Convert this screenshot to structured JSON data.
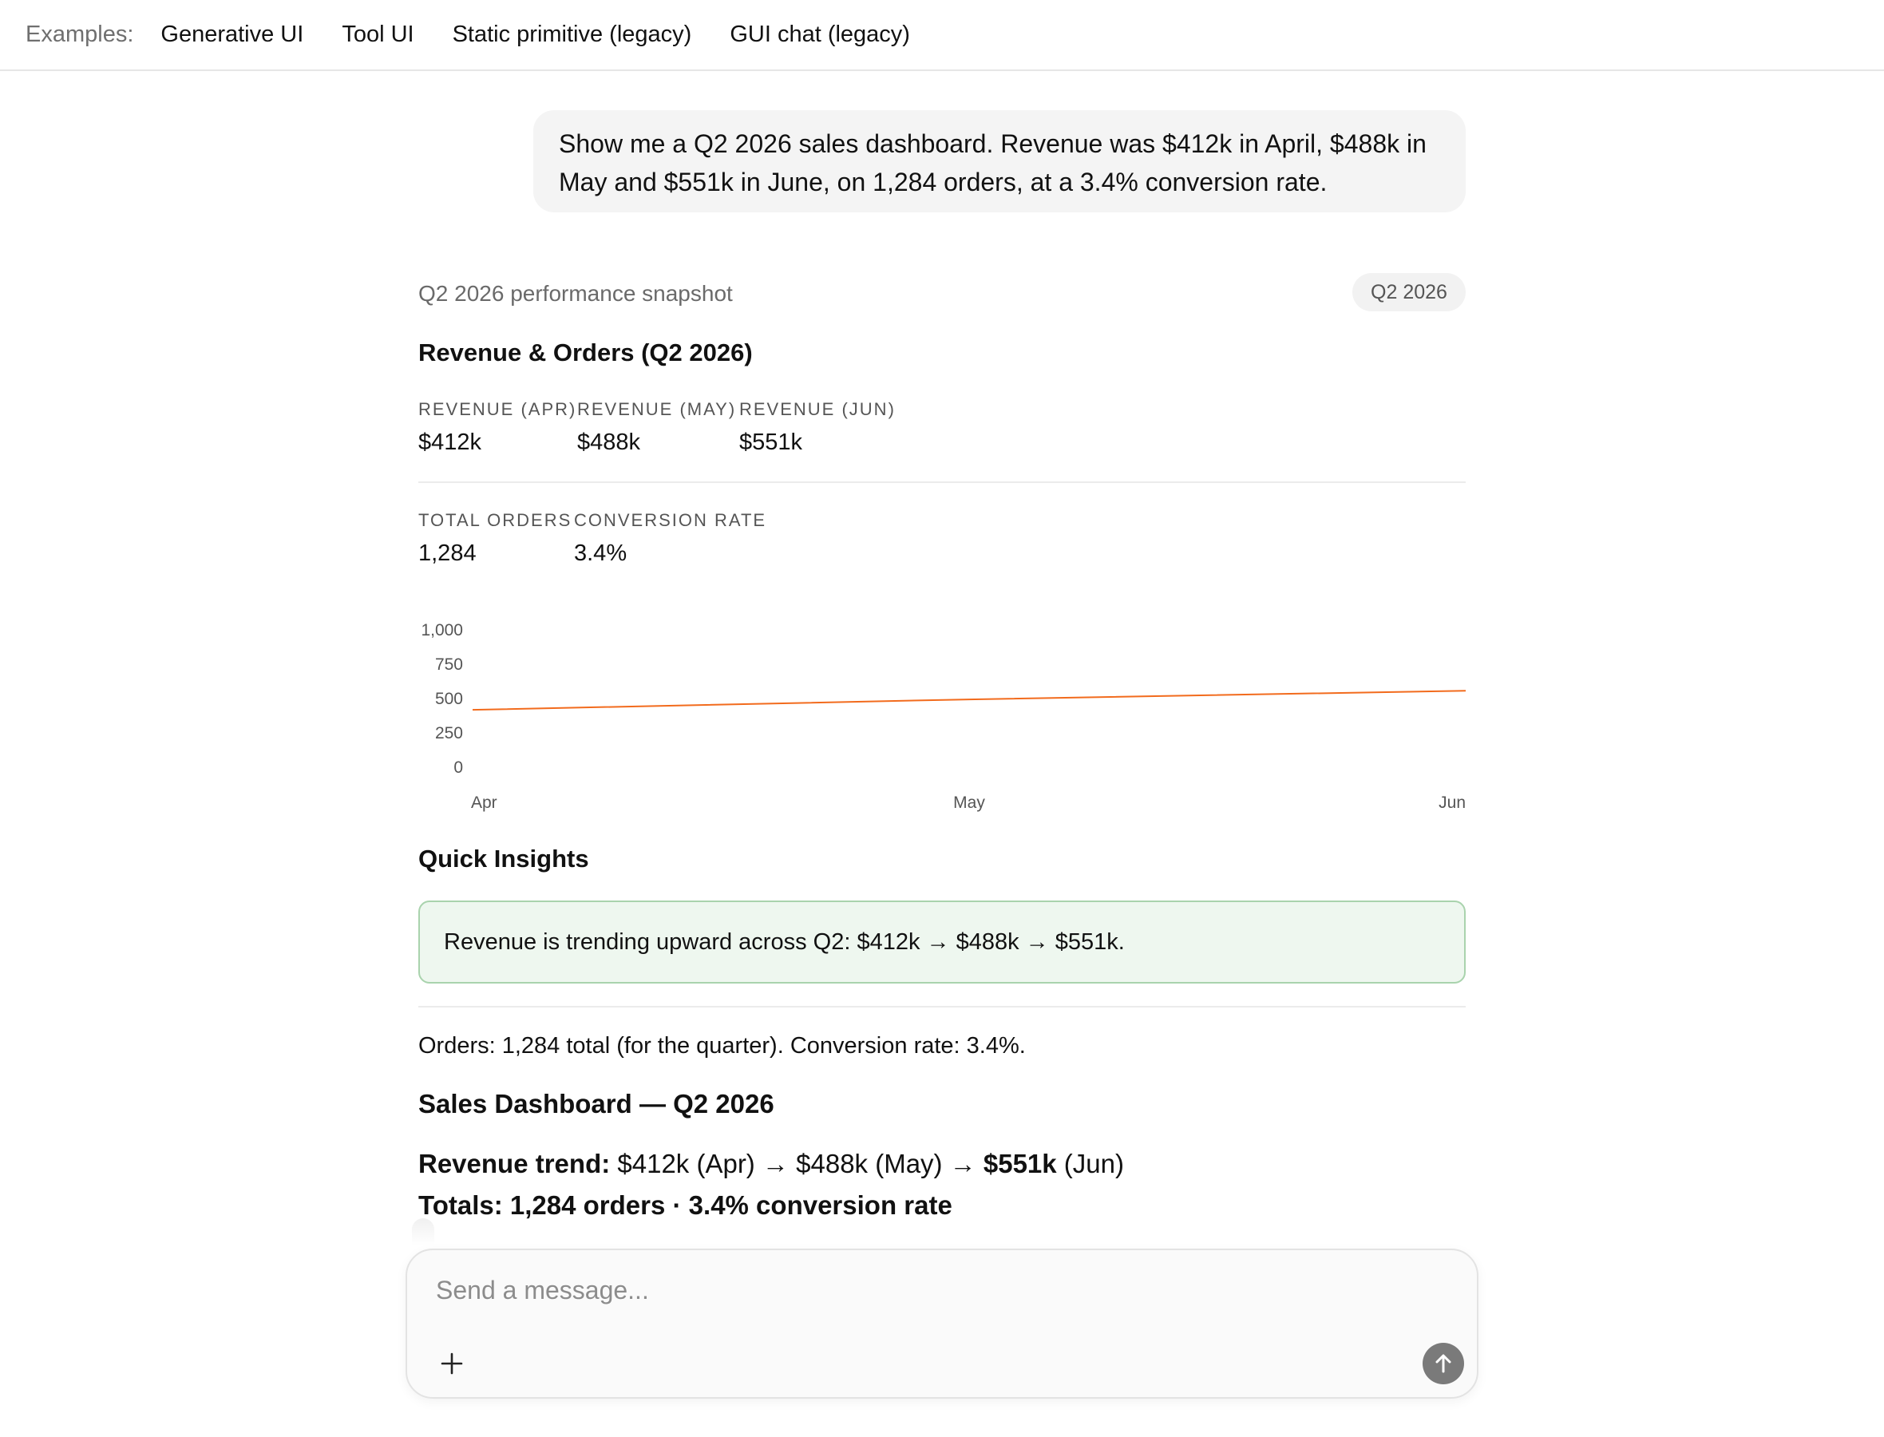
{
  "topbar": {
    "examples_label": "Examples:",
    "links": [
      "Generative UI",
      "Tool UI",
      "Static primitive (legacy)",
      "GUI chat (legacy)"
    ]
  },
  "user_message": "Show me a Q2 2026 sales dashboard. Revenue was $412k in April, $488k in May and $551k in June, on 1,284 orders, at a 3.4% conversion rate.",
  "dashboard": {
    "snapshot_title": "Q2 2026 performance snapshot",
    "period_badge": "Q2 2026",
    "section_title": "Revenue & Orders (Q2 2026)",
    "revenue_metrics": [
      {
        "label": "Revenue (Apr)",
        "value": "$412k"
      },
      {
        "label": "Revenue (May)",
        "value": "$488k"
      },
      {
        "label": "Revenue (Jun)",
        "value": "$551k"
      }
    ],
    "order_metrics": [
      {
        "label": "Total Orders",
        "value": "1,284"
      },
      {
        "label": "Conversion Rate",
        "value": "3.4%"
      }
    ]
  },
  "chart_data": {
    "type": "line",
    "x": [
      "Apr",
      "May",
      "Jun"
    ],
    "series": [
      {
        "values": [
          412,
          488,
          551
        ],
        "color": "#f26b1d"
      }
    ],
    "ylim": [
      0,
      1000
    ],
    "yticks": [
      "1,000",
      "750",
      "500",
      "250",
      "0"
    ],
    "ytick_values": [
      1000,
      750,
      500,
      250,
      0
    ],
    "grid": false,
    "title": "",
    "xlabel": "",
    "ylabel": ""
  },
  "insights": {
    "title": "Quick Insights",
    "card_text": "Revenue is trending upward across Q2: $412k → $488k → $551k.",
    "orders_text": "Orders: 1,284 total (for the quarter). Conversion rate: 3.4%."
  },
  "summary": {
    "title": "Sales Dashboard — Q2 2026",
    "trend_label": "Revenue trend:",
    "trend_part1": " $412k (Apr) → $488k (May) → ",
    "trend_bold": "$551k",
    "trend_part2": " (Jun)",
    "totals_line": "Totals: 1,284 orders · 3.4% conversion rate"
  },
  "composer": {
    "placeholder": "Send a message..."
  },
  "colors": {
    "accent_line": "#f26b1d",
    "insight_bg": "#eef7ef",
    "insight_border": "#a9d3ad",
    "send_button": "#7a7a7a"
  },
  "icons": [
    "plus-icon",
    "arrow-up-icon"
  ]
}
